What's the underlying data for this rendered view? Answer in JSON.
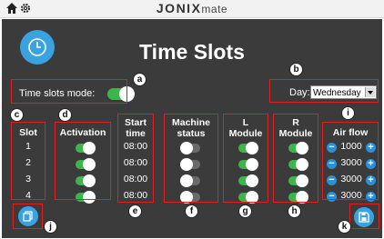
{
  "brand": {
    "part1": "JONIX",
    "part2": "mate"
  },
  "title": "Time Slots",
  "mode": {
    "label": "Time slots mode:",
    "enabled": true
  },
  "day": {
    "label": "Day:",
    "selected": "Wednesday"
  },
  "headers": {
    "slot": "Slot",
    "activation": "Activation",
    "start_line1": "Start",
    "start_line2": "time",
    "machine_line1": "Machine",
    "machine_line2": "status",
    "lmod_line1": "L",
    "lmod_line2": "Module",
    "rmod_line1": "R",
    "rmod_line2": "Module",
    "airflow": "Air flow"
  },
  "rows": [
    {
      "slot": "1",
      "activation": true,
      "start": "08:00",
      "machine": false,
      "lmodule": true,
      "rmodule": true,
      "airflow": "1000"
    },
    {
      "slot": "2",
      "activation": true,
      "start": "08:00",
      "machine": false,
      "lmodule": true,
      "rmodule": true,
      "airflow": "3000"
    },
    {
      "slot": "3",
      "activation": true,
      "start": "08:00",
      "machine": false,
      "lmodule": true,
      "rmodule": true,
      "airflow": "3000"
    },
    {
      "slot": "4",
      "activation": true,
      "start": "08:00",
      "machine": false,
      "lmodule": true,
      "rmodule": true,
      "airflow": "3000"
    }
  ],
  "airflow_controls": {
    "minus": "−",
    "plus": "+"
  },
  "annotations": [
    "a",
    "b",
    "c",
    "d",
    "e",
    "f",
    "g",
    "h",
    "i",
    "j",
    "k"
  ],
  "icons": {
    "home": "home-icon",
    "settings": "gear-icon",
    "clock": "clock-icon",
    "copy": "copy-icon",
    "save": "save-icon"
  },
  "colors": {
    "screen_bg": "#3b3b3b",
    "accent_blue": "#3aa2df",
    "toggle_on": "#3db54a",
    "toggle_off": "#6a6a6a",
    "annotation_red": "#e02020"
  }
}
